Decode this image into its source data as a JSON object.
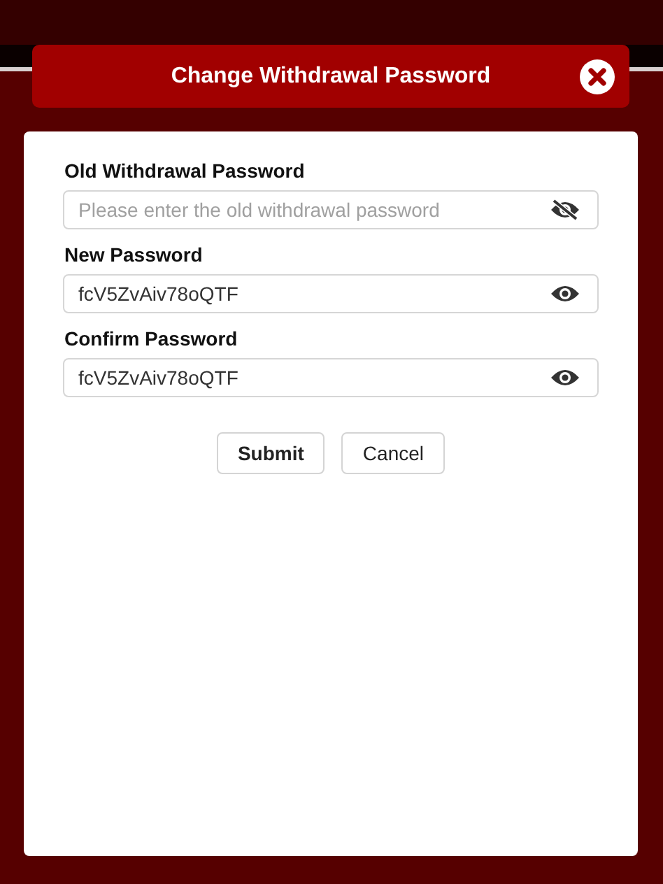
{
  "dialog": {
    "title": "Change Withdrawal Password"
  },
  "fields": [
    {
      "label": "Old Withdrawal Password",
      "placeholder": "Please enter the old withdrawal password",
      "visible": false
    },
    {
      "label": "New Password",
      "value": "fcV5ZvAiv78oQTF",
      "visible": true
    },
    {
      "label": "Confirm Password",
      "value": "fcV5ZvAiv78oQTF",
      "visible": true
    }
  ],
  "buttons": [
    {
      "label": "Submit",
      "kind": "primary"
    },
    {
      "label": "Cancel",
      "kind": "secondary"
    }
  ]
}
